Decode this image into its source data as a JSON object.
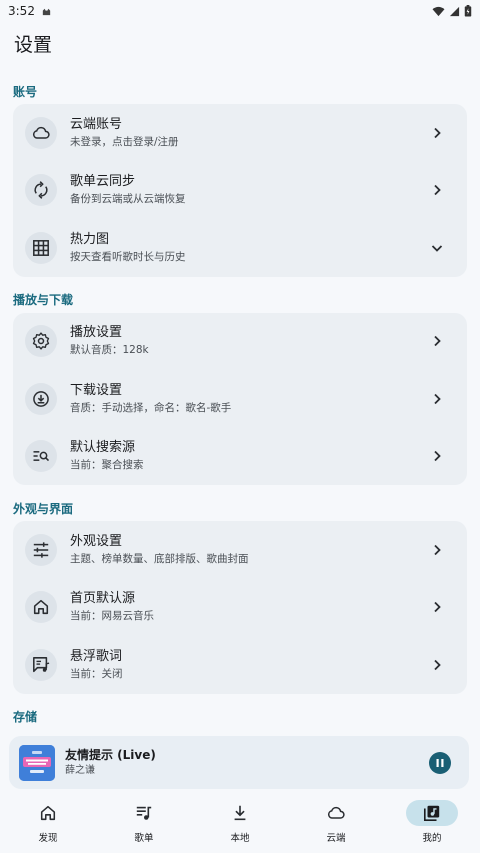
{
  "status_bar": {
    "time": "3:52"
  },
  "page": {
    "title": "设置"
  },
  "sections": [
    {
      "header": "账号",
      "rows": [
        {
          "title": "云端账号",
          "subtitle": "未登录，点击登录/注册",
          "icon": "cloud-icon",
          "trail": "chevron-right"
        },
        {
          "title": "歌单云同步",
          "subtitle": "备份到云端或从云端恢复",
          "icon": "sync-icon",
          "trail": "chevron-right"
        },
        {
          "title": "热力图",
          "subtitle": "按天查看听歌时长与历史",
          "icon": "grid-icon",
          "trail": "chevron-down"
        }
      ]
    },
    {
      "header": "播放与下载",
      "rows": [
        {
          "title": "播放设置",
          "subtitle": "默认音质：128k",
          "icon": "gear-icon",
          "trail": "chevron-right"
        },
        {
          "title": "下载设置",
          "subtitle": "音质：手动选择，命名：歌名-歌手",
          "icon": "download-circle-icon",
          "trail": "chevron-right"
        },
        {
          "title": "默认搜索源",
          "subtitle": "当前：聚合搜索",
          "icon": "search-list-icon",
          "trail": "chevron-right"
        }
      ]
    },
    {
      "header": "外观与界面",
      "rows": [
        {
          "title": "外观设置",
          "subtitle": "主题、榜单数量、底部排版、歌曲封面",
          "icon": "sliders-icon",
          "trail": "chevron-right"
        },
        {
          "title": "首页默认源",
          "subtitle": "当前：网易云音乐",
          "icon": "home-icon",
          "trail": "chevron-right"
        },
        {
          "title": "悬浮歌词",
          "subtitle": "当前：关闭",
          "icon": "lyrics-icon",
          "trail": "chevron-right"
        }
      ]
    },
    {
      "header": "存储",
      "rows": []
    }
  ],
  "player": {
    "title": "友情提示 (Live)",
    "artist": "薛之谦",
    "state": "playing"
  },
  "nav": [
    {
      "label": "发现",
      "icon": "home-icon",
      "active": false
    },
    {
      "label": "歌单",
      "icon": "playlist-icon",
      "active": false
    },
    {
      "label": "本地",
      "icon": "download-icon",
      "active": false
    },
    {
      "label": "云端",
      "icon": "cloud-icon",
      "active": false
    },
    {
      "label": "我的",
      "icon": "library-music-icon",
      "active": true
    }
  ],
  "colors": {
    "accent": "#1a6a7f",
    "card": "#ebeff3",
    "background": "#f6f8fb",
    "nav_active": "#c7e1eb"
  }
}
